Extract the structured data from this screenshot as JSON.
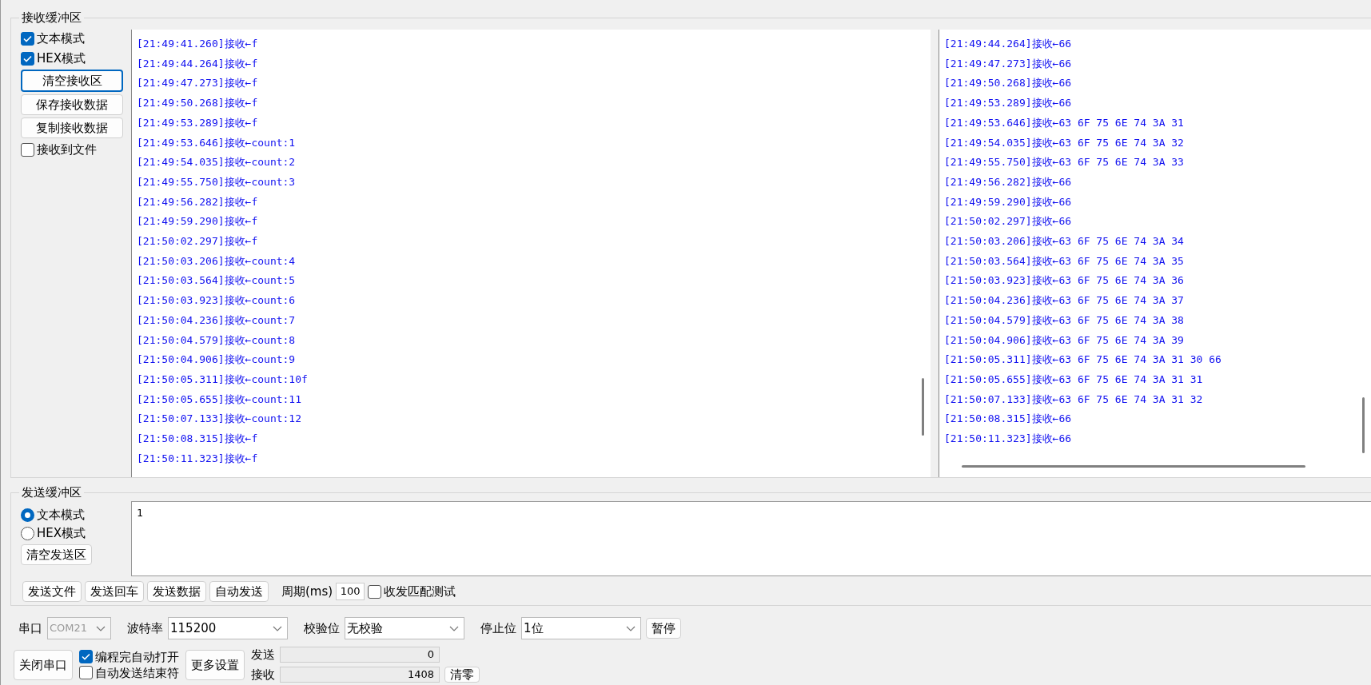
{
  "receive": {
    "title": "接收缓冲区",
    "controls": [
      {
        "kind": "checkbox",
        "label": "文本模式",
        "checked": true
      },
      {
        "kind": "checkbox",
        "label": "HEX模式",
        "checked": true
      },
      {
        "kind": "button",
        "label": "清空接收区",
        "focused": true
      },
      {
        "kind": "button",
        "label": "保存接收数据",
        "focused": false
      },
      {
        "kind": "button",
        "label": "复制接收数据",
        "focused": false
      },
      {
        "kind": "checkbox",
        "label": "接收到文件",
        "checked": false
      }
    ],
    "text_log": [
      "[21:49:41.260]接收←f",
      "[21:49:44.264]接收←f",
      "[21:49:47.273]接收←f",
      "[21:49:50.268]接收←f",
      "[21:49:53.289]接收←f",
      "[21:49:53.646]接收←count:1",
      "[21:49:54.035]接收←count:2",
      "[21:49:55.750]接收←count:3",
      "[21:49:56.282]接收←f",
      "[21:49:59.290]接收←f",
      "[21:50:02.297]接收←f",
      "[21:50:03.206]接收←count:4",
      "[21:50:03.564]接收←count:5",
      "[21:50:03.923]接收←count:6",
      "[21:50:04.236]接收←count:7",
      "[21:50:04.579]接收←count:8",
      "[21:50:04.906]接收←count:9",
      "[21:50:05.311]接收←count:10f",
      "[21:50:05.655]接收←count:11",
      "[21:50:07.133]接收←count:12",
      "[21:50:08.315]接收←f",
      "[21:50:11.323]接收←f"
    ],
    "hex_log": [
      "[21:49:44.264]接收←66",
      "[21:49:47.273]接收←66",
      "[21:49:50.268]接收←66",
      "[21:49:53.289]接收←66",
      "[21:49:53.646]接收←63 6F 75 6E 74 3A 31",
      "[21:49:54.035]接收←63 6F 75 6E 74 3A 32",
      "[21:49:55.750]接收←63 6F 75 6E 74 3A 33",
      "[21:49:56.282]接收←66",
      "[21:49:59.290]接收←66",
      "[21:50:02.297]接收←66",
      "[21:50:03.206]接收←63 6F 75 6E 74 3A 34",
      "[21:50:03.564]接收←63 6F 75 6E 74 3A 35",
      "[21:50:03.923]接收←63 6F 75 6E 74 3A 36",
      "[21:50:04.236]接收←63 6F 75 6E 74 3A 37",
      "[21:50:04.579]接收←63 6F 75 6E 74 3A 38",
      "[21:50:04.906]接收←63 6F 75 6E 74 3A 39",
      "[21:50:05.311]接收←63 6F 75 6E 74 3A 31 30 66",
      "[21:50:05.655]接收←63 6F 75 6E 74 3A 31 31",
      "[21:50:07.133]接收←63 6F 75 6E 74 3A 31 32",
      "[21:50:08.315]接收←66",
      "[21:50:11.323]接收←66"
    ]
  },
  "send": {
    "title": "发送缓冲区",
    "modes": [
      {
        "label": "文本模式",
        "selected": true
      },
      {
        "label": "HEX模式",
        "selected": false
      }
    ],
    "clear_button": "清空发送区",
    "value": "1",
    "buttons": [
      "发送文件",
      "发送回车",
      "发送数据",
      "自动发送"
    ],
    "period_label": "周期(ms)",
    "period": "100",
    "match_test": {
      "label": "收发匹配测试",
      "checked": false
    }
  },
  "serial": {
    "fields": [
      {
        "label": "串口",
        "value": "COM21",
        "disabled": true
      },
      {
        "label": "波特率",
        "value": "115200",
        "disabled": false
      },
      {
        "label": "校验位",
        "value": "无校验",
        "disabled": false
      },
      {
        "label": "停止位",
        "value": "1位",
        "disabled": false
      }
    ],
    "pause_button": "暂停"
  },
  "bottom": {
    "close_button": "关闭串口",
    "options": [
      {
        "label": "编程完自动打开",
        "checked": true
      },
      {
        "label": "自动发送结束符",
        "checked": false
      }
    ],
    "more_button": "更多设置",
    "counters": [
      {
        "label": "发送",
        "value": "0"
      },
      {
        "label": "接收",
        "value": "1408"
      }
    ],
    "clear_button": "清零"
  }
}
